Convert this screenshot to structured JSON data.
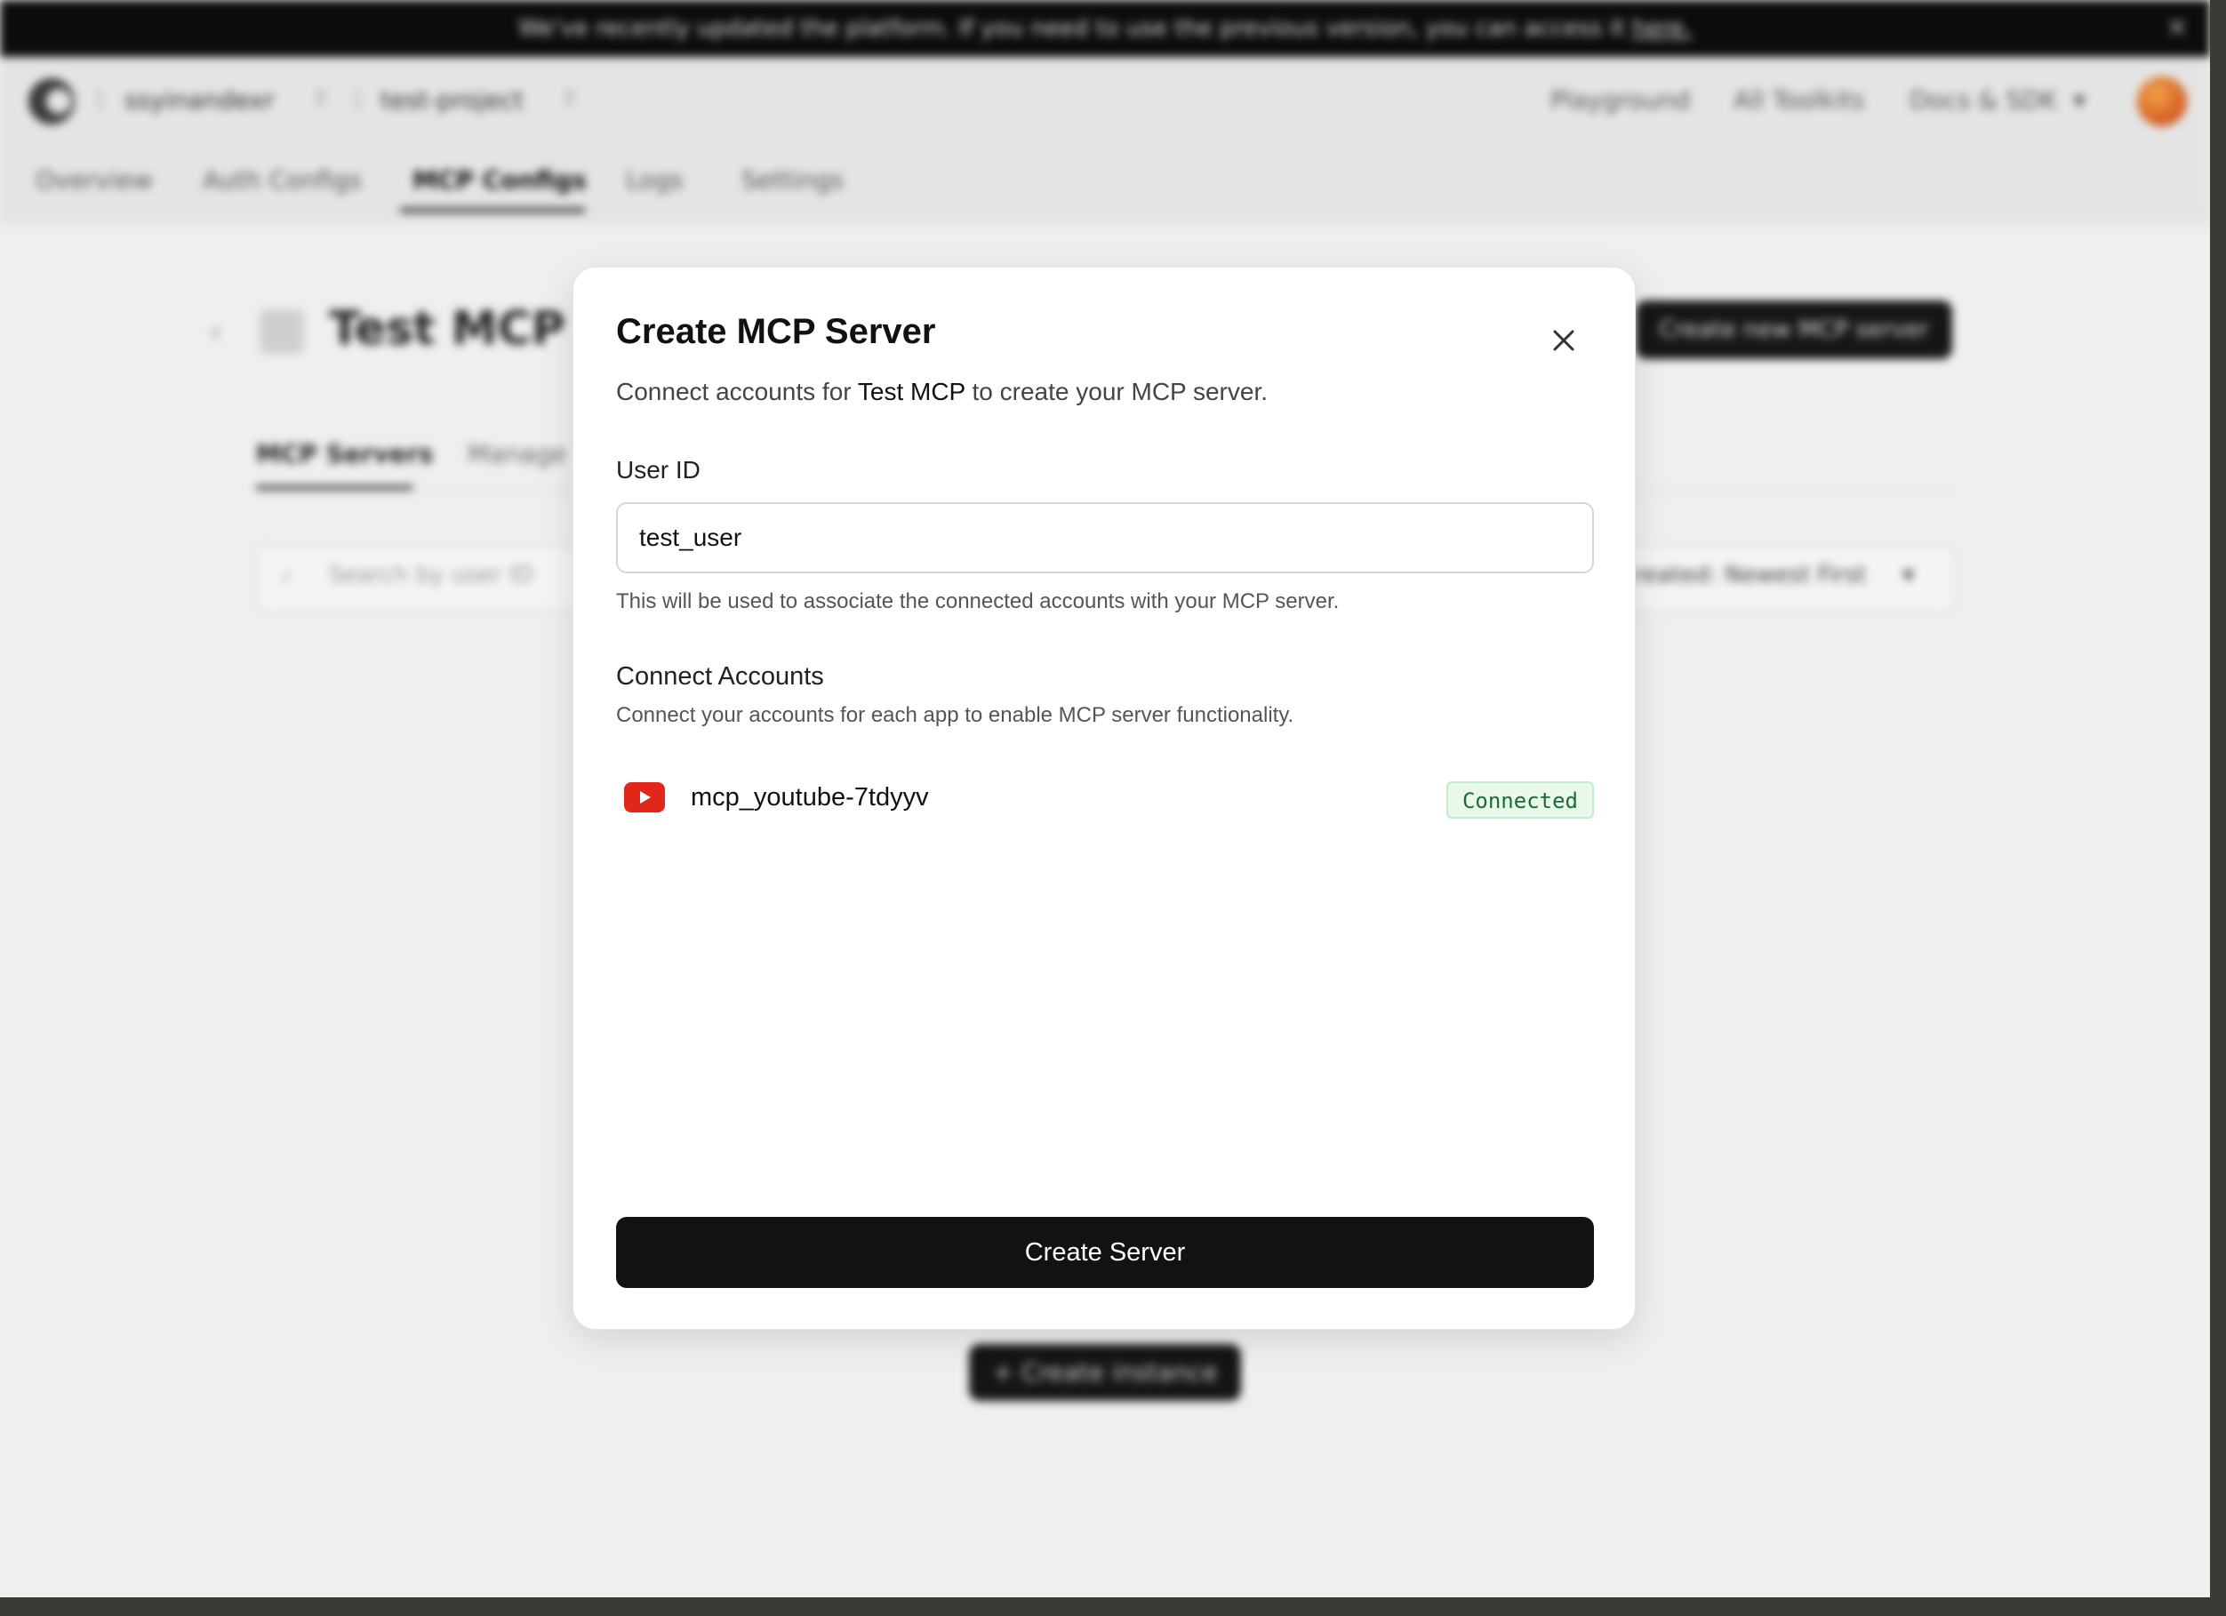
{
  "banner": {
    "text": "We've recently updated the platform. If you need to use the previous version, you can access it ",
    "link": "here."
  },
  "topnav": {
    "org": "ssyinandexr",
    "project": "test-project",
    "links": [
      "Playground",
      "All Toolkits",
      "Docs & SDK"
    ]
  },
  "subtabs": [
    "Overview",
    "Auth Configs",
    "MCP Configs",
    "Logs",
    "Settings"
  ],
  "page": {
    "title": "Test MCP",
    "create_new_button": "Create new MCP server",
    "tabs": [
      "MCP Servers",
      "Manage"
    ],
    "search_placeholder": "Search by user ID",
    "sort_label": "Created: Newest First",
    "create_instance_button": "Create instance"
  },
  "modal": {
    "title": "Create MCP Server",
    "description_prefix": "Connect accounts for ",
    "description_name": "Test MCP",
    "description_suffix": " to create your MCP server.",
    "user_id_label": "User ID",
    "user_id_value": "test_user",
    "user_id_help": "This will be used to associate the connected accounts with your MCP server.",
    "connect_title": "Connect Accounts",
    "connect_desc": "Connect your accounts for each app to enable MCP server functionality.",
    "accounts": [
      {
        "name": "mcp_youtube-7tdyyv",
        "status": "Connected",
        "icon": "youtube-icon"
      }
    ],
    "create_button": "Create Server"
  },
  "colors": {
    "status_green_bg": "#e8f8eb",
    "status_green_text": "#1d6b33",
    "youtube_red": "#e1261c",
    "primary_button": "#121212"
  }
}
